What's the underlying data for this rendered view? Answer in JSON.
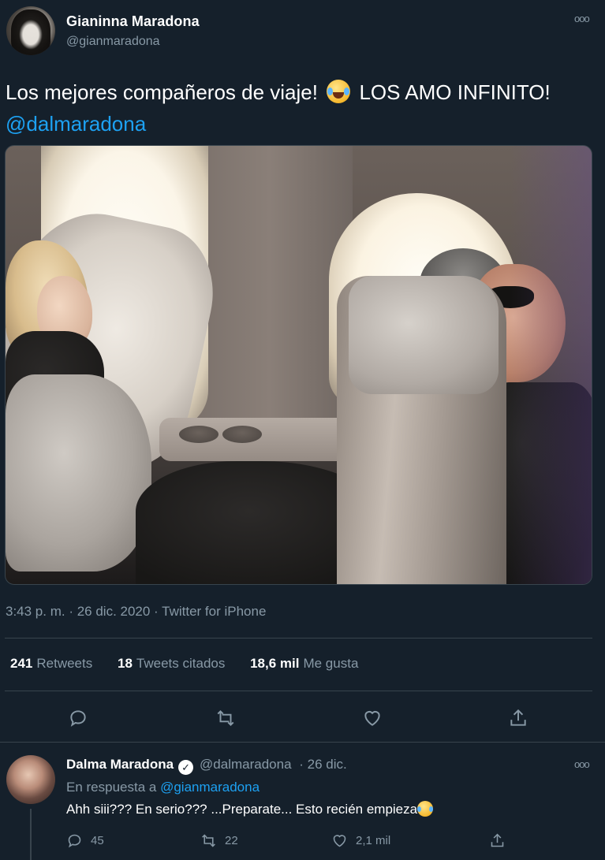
{
  "tweet": {
    "author_name": "Gianinna Maradona",
    "author_handle": "@gianmaradona",
    "text_part1": "Los mejores compañeros de viaje!",
    "text_part2": "LOS AMO INFINITO!",
    "mention": "@dalmaradona",
    "emoji": "face-with-tears-of-joy-icon",
    "more_icon": "more-icon",
    "timestamp": "3:43 p. m. · 26 dic. 2020 · Twitter for iPhone",
    "stats": [
      {
        "count": "241",
        "label": "Retweets"
      },
      {
        "count": "18",
        "label": "Tweets citados"
      },
      {
        "count": "18,6 mil",
        "label": "Me gusta"
      }
    ],
    "actions": [
      "reply-icon",
      "retweet-icon",
      "like-icon",
      "share-icon"
    ]
  },
  "reply": {
    "author_name": "Dalma Maradona",
    "author_handle": "@dalmaradona",
    "date": "· 26 dic.",
    "reply_to_prefix": "En respuesta a",
    "reply_to_handle": "@gianmaradona",
    "text": "Ahh siii??? En serio??? ...Preparate... Esto recién empieza",
    "reply_count": "45",
    "retweet_count": "22",
    "like_count": "2,1 mil"
  },
  "colors": {
    "background": "#15202b",
    "secondary_text": "#8899a6",
    "link": "#1da1f2",
    "divider": "#38444d"
  }
}
